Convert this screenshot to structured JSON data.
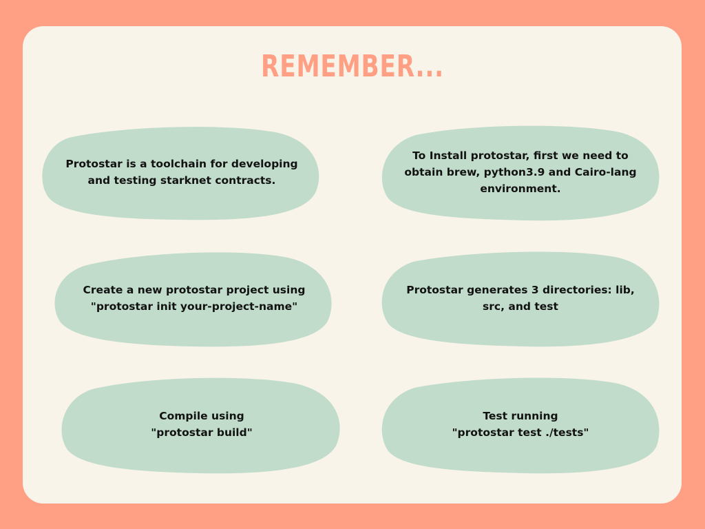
{
  "title": "REMEMBER...",
  "colors": {
    "background": "#ff9f84",
    "card": "#f8f4ea",
    "bubble": "#c1dccb",
    "title": "#ff9f84",
    "text": "#121212"
  },
  "notes": [
    {
      "text": "Protostar is a toolchain for developing\nand testing starknet contracts."
    },
    {
      "text": "To Install protostar, first we need to\nobtain brew, python3.9 and Cairo-lang\nenvironment."
    },
    {
      "text": "Create a new protostar project using\n\"protostar init your-project-name\""
    },
    {
      "text": "Protostar generates 3 directories: lib,\nsrc, and test"
    },
    {
      "text": "Compile using\n\"protostar build\""
    },
    {
      "text": "Test running\n\"protostar test ./tests\""
    }
  ]
}
